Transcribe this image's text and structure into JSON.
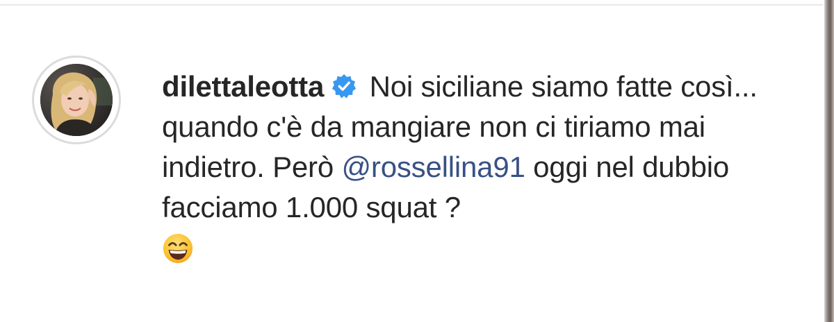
{
  "comment": {
    "username": "dilettaleotta",
    "verified": true,
    "text_part1": " Noi siciliane siamo fatte così... quando c'è da mangiare non ci tiriamo mai indietro. Però ",
    "mention": "@rossellina91",
    "text_part2": " oggi nel dubbio facciamo 1.000 squat ?",
    "emoji": "grinning-face-with-smiling-eyes-icon"
  },
  "colors": {
    "text": "#262626",
    "mention": "#385185",
    "verified_badge": "#3897f0",
    "avatar_ring": "#dbdbdb"
  },
  "icons": {
    "verified": "verified-badge-icon",
    "avatar": "profile-avatar"
  }
}
